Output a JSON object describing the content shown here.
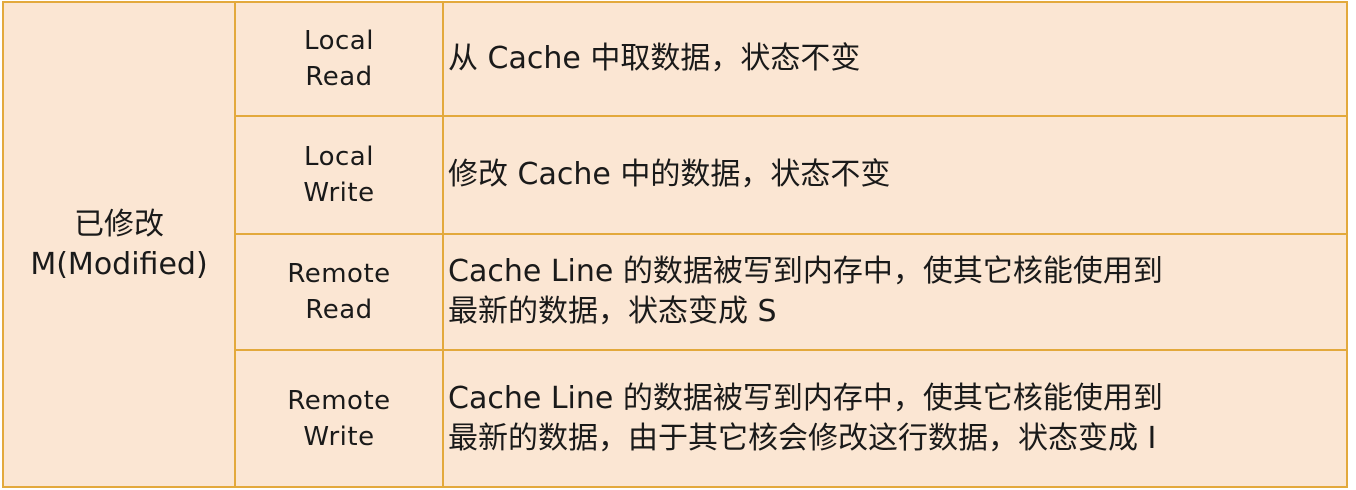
{
  "state": {
    "name_cn": "已修改",
    "name_en": "M(Modified)"
  },
  "rows": [
    {
      "event_line1": "Local",
      "event_line2": "Read",
      "desc_line1": "从 Cache 中取数据，状态不变",
      "desc_line2": ""
    },
    {
      "event_line1": "Local",
      "event_line2": "Write",
      "desc_line1": "修改 Cache 中的数据，状态不变",
      "desc_line2": ""
    },
    {
      "event_line1": "Remote",
      "event_line2": "Read",
      "desc_line1": "Cache Line 的数据被写到内存中，使其它核能使用到",
      "desc_line2": "最新的数据，状态变成 S"
    },
    {
      "event_line1": "Remote",
      "event_line2": "Write",
      "desc_line1": "Cache Line 的数据被写到内存中，使其它核能使用到",
      "desc_line2": "最新的数据，由于其它核会修改这行数据，状态变成 I"
    }
  ]
}
